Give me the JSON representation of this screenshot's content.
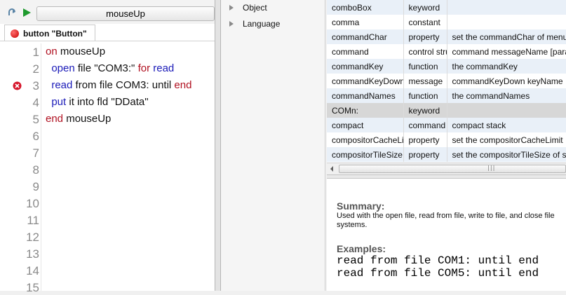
{
  "editor": {
    "handler_select": "mouseUp",
    "tab_label": "button \"Button\"",
    "line_numbers": [
      "1",
      "2",
      "3",
      "4",
      "5",
      "6",
      "7",
      "8",
      "9",
      "10",
      "11",
      "12",
      "13",
      "14",
      "15"
    ],
    "lines": [
      {
        "indent": "",
        "tokens": [
          {
            "t": "on",
            "c": "red"
          },
          {
            "t": " mouseUp",
            "c": ""
          }
        ]
      },
      {
        "indent": "  ",
        "tokens": [
          {
            "t": "open",
            "c": "blue"
          },
          {
            "t": " file \"COM3:\" ",
            "c": ""
          },
          {
            "t": "for",
            "c": "red"
          },
          {
            "t": " ",
            "c": ""
          },
          {
            "t": "read",
            "c": "blue"
          }
        ]
      },
      {
        "indent": "  ",
        "tokens": [
          {
            "t": "read",
            "c": "blue"
          },
          {
            "t": " from file COM3: until ",
            "c": ""
          },
          {
            "t": "end",
            "c": "red"
          }
        ]
      },
      {
        "indent": "  ",
        "tokens": [
          {
            "t": "put",
            "c": "blue"
          },
          {
            "t": " it into fld \"DData\"",
            "c": ""
          }
        ]
      },
      {
        "indent": "",
        "tokens": [
          {
            "t": "end",
            "c": "red"
          },
          {
            "t": " mouseUp",
            "c": ""
          }
        ]
      }
    ],
    "error_line": 3
  },
  "tree": {
    "items": [
      "Object",
      "Language"
    ]
  },
  "dictionary": {
    "rows": [
      {
        "name": "comboBox",
        "type": "keyword",
        "syntax": ""
      },
      {
        "name": "comma",
        "type": "constant",
        "syntax": ""
      },
      {
        "name": "commandChar",
        "type": "property",
        "syntax": "set the commandChar of menu"
      },
      {
        "name": "command",
        "type": "control stru",
        "syntax": "command messageName [para"
      },
      {
        "name": "commandKey",
        "type": "function",
        "syntax": "the commandKey"
      },
      {
        "name": "commandKeyDown",
        "type": "message",
        "syntax": "commandKeyDown keyName"
      },
      {
        "name": "commandNames",
        "type": "function",
        "syntax": "the commandNames"
      },
      {
        "name": "COMn:",
        "type": "keyword",
        "syntax": ""
      },
      {
        "name": "compact",
        "type": "command",
        "syntax": "compact stack"
      },
      {
        "name": "compositorCacheLimit",
        "type": "property",
        "syntax": "set the compositorCacheLimit"
      },
      {
        "name": "compositorTileSize",
        "type": "property",
        "syntax": "set the compositorTileSize of st"
      }
    ],
    "selected_index": 7
  },
  "docs": {
    "summary_heading": "Summary:",
    "summary_text": "Used with the open file, read from file, write to file, and close file systems.",
    "examples_heading": "Examples:",
    "examples": [
      "read from file COM1: until end",
      "read from file COM5: until end"
    ]
  },
  "colors": {
    "keyword_red": "#b01020",
    "keyword_blue": "#1a1ab8",
    "selected_row": "#d7d7d7",
    "alt_row": "#e9f0f8"
  }
}
